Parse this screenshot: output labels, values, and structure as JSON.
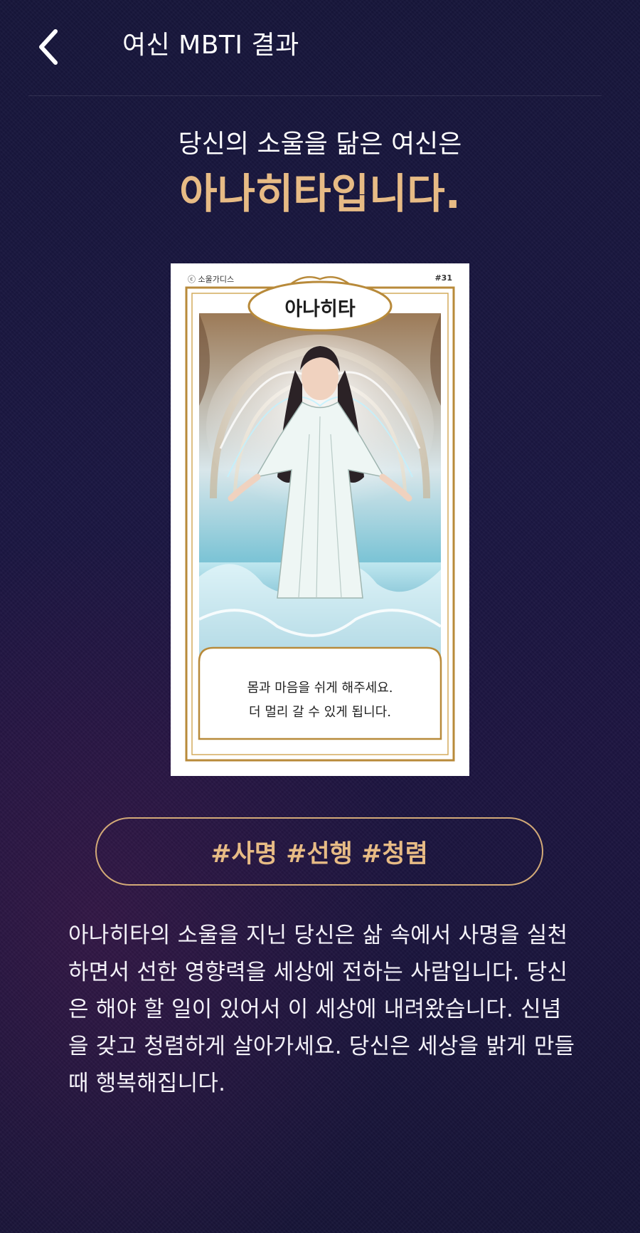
{
  "header": {
    "title": "여신 MBTI 결과",
    "back_icon": "chevron-left-icon"
  },
  "result": {
    "subtitle": "당신의 소울을 닮은 여신은",
    "title": "아나히타입니다."
  },
  "card": {
    "publisher": "ⓒ 소울가디스",
    "number": "#31",
    "name": "아나히타",
    "message_line1": "몸과 마음을 쉬게 해주세요.",
    "message_line2": "더 멀리 갈 수 있게 됩니다."
  },
  "hashtags": "#사명 #선행 #청렴",
  "description": "아나히타의 소울을 지닌 당신은 삶 속에서 사명을 실천하면서 선한 영향력을 세상에 전하는 사람입니다. 당신은 해야 할 일이 있어서 이 세상에 내려왔습니다. 신념을 갖고 청렴하게 살아가세요. 당신은 세상을 밝게 만들 때  행복해집니다.",
  "colors": {
    "background": "#1a1641",
    "accent": "#e7bb85",
    "pill_border": "#d2a977",
    "card_frame": "#b88a3a"
  }
}
